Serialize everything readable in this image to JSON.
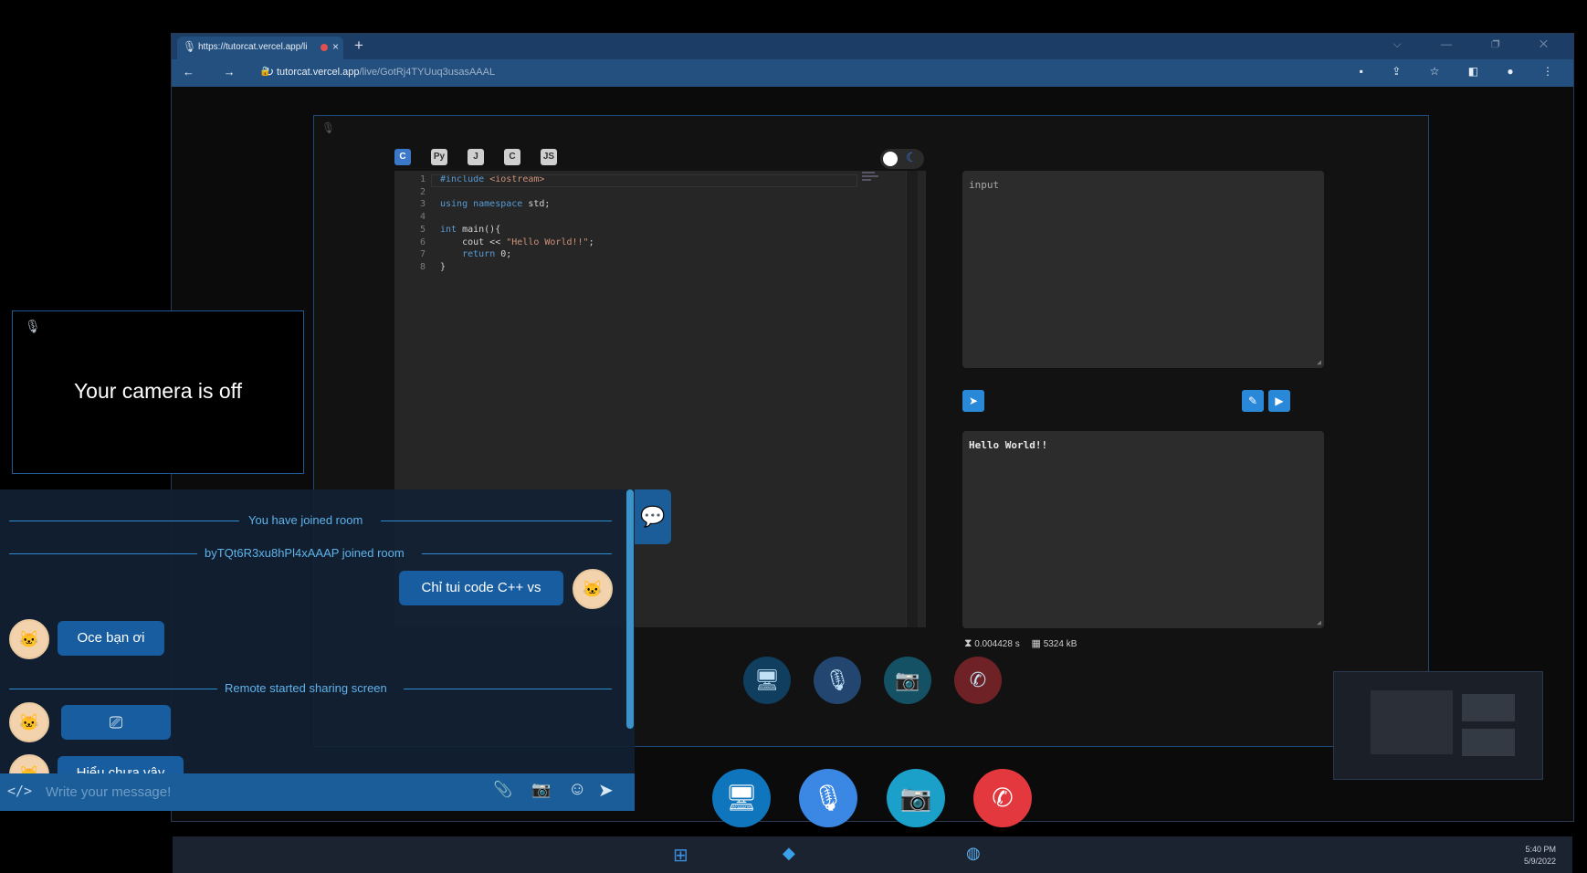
{
  "browser": {
    "tab_url": "https://tutorcat.vercel.app/li",
    "tab_close": "×",
    "new_tab": "+",
    "window_controls": "⌵ — ❐ ✕",
    "nav": "← → ↻",
    "address_host": "tutorcat.vercel.app",
    "address_path": "/live/GotRj4TYUuq3usasAAAL",
    "tools": "▪ ⇪ ☆ ◧ ● ⋮"
  },
  "languages": [
    {
      "label": "C",
      "name": "cpp-icon"
    },
    {
      "label": "Py",
      "name": "python-icon"
    },
    {
      "label": "J",
      "name": "java-icon"
    },
    {
      "label": "C",
      "name": "c-icon"
    },
    {
      "label": "JS",
      "name": "javascript-icon"
    }
  ],
  "editor": {
    "lines": [
      {
        "n": "1",
        "html": "<span class=\"pp\">#include</span> <span class=\"inc\">&lt;iostream&gt;</span>"
      },
      {
        "n": "2",
        "html": ""
      },
      {
        "n": "3",
        "html": "<span class=\"kw\">using namespace</span> std;"
      },
      {
        "n": "4",
        "html": ""
      },
      {
        "n": "5",
        "html": "<span class=\"kw\">int</span> main(){"
      },
      {
        "n": "6",
        "html": "    cout &lt;&lt; <span class=\"str\">\"Hello World!!\"</span>;"
      },
      {
        "n": "7",
        "html": "    <span class=\"kw\">return</span> 0;"
      },
      {
        "n": "8",
        "html": "}"
      }
    ]
  },
  "io": {
    "input_placeholder": "input",
    "output_text": "Hello World!!",
    "time": "0.004428 s",
    "memory": "5324 kB"
  },
  "camera": {
    "message": "Your camera is off",
    "mic_icon": "🎙"
  },
  "chat": {
    "system_joined": "You have joined room",
    "system_user_joined": "byTQt6R3xu8hPl4xAAAP joined room",
    "msg_mine": "Chỉ tui code C++ vs",
    "msg_remote_1": "Oce bạn ơi",
    "system_share": "Remote started sharing screen",
    "msg_remote_partial": "Hiểu chưa vậy",
    "input_placeholder": "Write your message!",
    "code_icon": "</>",
    "attach_icon": "📎",
    "camera_icon": "📷",
    "emoji_icon": "☺",
    "send_icon": "➤"
  },
  "taskbar": {
    "time": "5:40 PM",
    "date": "5/9/2022"
  },
  "colors": {
    "accent": "#1a5d99",
    "bubble": "#175da0",
    "end_call": "#e3383e",
    "mic": "#3a87e4",
    "video": "#1aa0c9",
    "screen": "#0f76bd"
  }
}
